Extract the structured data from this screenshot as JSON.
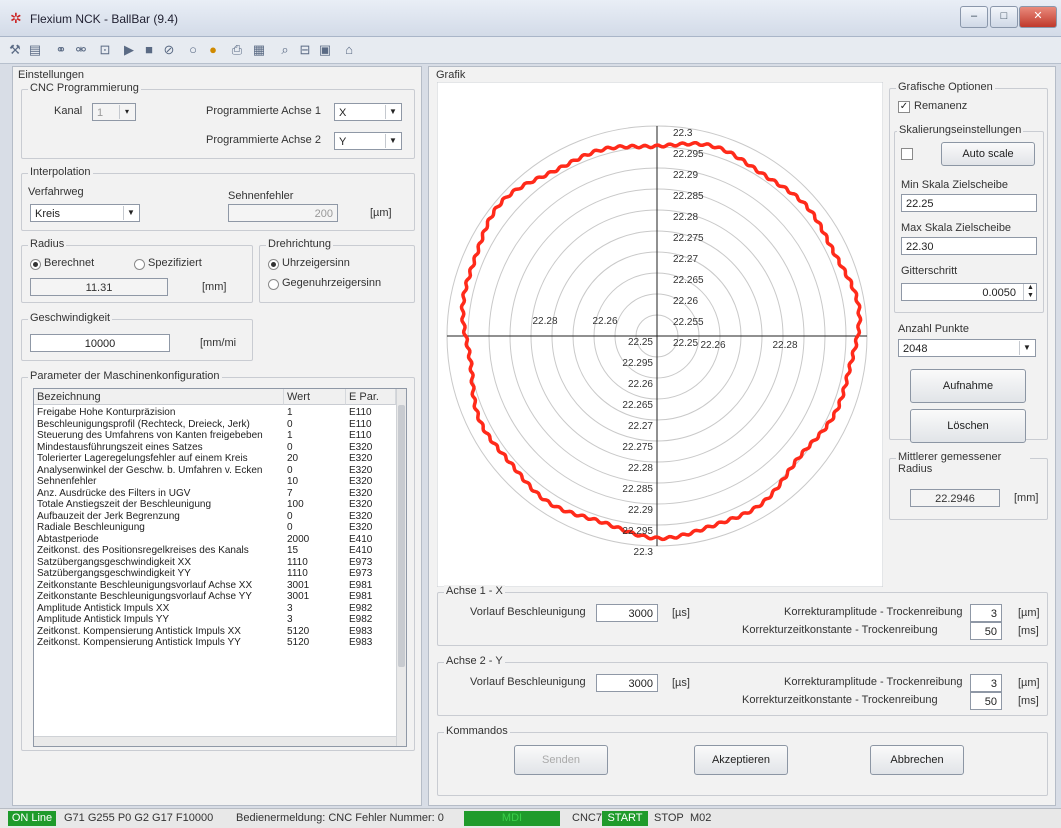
{
  "window": {
    "title": "Flexium NCK - BallBar (9.4)",
    "min": "–",
    "max": "□",
    "close": "✕"
  },
  "settings": {
    "title": "Einstellungen",
    "cnc": {
      "title": "CNC Programmierung",
      "kanal_label": "Kanal",
      "kanal_value": "1",
      "achse1_label": "Programmierte Achse 1",
      "achse1_value": "X",
      "achse2_label": "Programmierte Achse 2",
      "achse2_value": "Y"
    },
    "interpolation": {
      "title": "Interpolation",
      "verfahrweg_label": "Verfahrweg",
      "verfahrweg_value": "Kreis",
      "sehnenfehler_label": "Sehnenfehler",
      "sehnenfehler_value": "200",
      "unit": "[µm]"
    },
    "radius": {
      "title": "Radius",
      "opt1": "Berechnet",
      "opt2": "Spezifiziert",
      "value": "11.31",
      "unit": "[mm]"
    },
    "drehrichtung": {
      "title": "Drehrichtung",
      "opt1": "Uhrzeigersinn",
      "opt2": "Gegenuhrzeigersinn"
    },
    "geschwindigkeit": {
      "title": "Geschwindigkeit",
      "value": "10000",
      "unit": "[mm/mi"
    }
  },
  "params": {
    "title": "Parameter der Maschinenkonfiguration",
    "headers": [
      "Bezeichnung",
      "Wert",
      "E Par."
    ],
    "rows": [
      [
        "Freigabe Hohe Konturpräzision",
        "1",
        "E110"
      ],
      [
        "Beschleunigungsprofil (Rechteck, Dreieck, Jerk)",
        "0",
        "E110"
      ],
      [
        "Steuerung des Umfahrens von Kanten freigebeben",
        "1",
        "E110"
      ],
      [
        "Mindestausführungszeit eines Satzes",
        "0",
        "E320"
      ],
      [
        "Tolerierter Lageregelungsfehler auf einem Kreis",
        "20",
        "E320"
      ],
      [
        "Analysenwinkel der Geschw. b. Umfahren v. Ecken",
        "0",
        "E320"
      ],
      [
        "Sehnenfehler",
        "10",
        "E320"
      ],
      [
        "Anz. Ausdrücke des Filters in UGV",
        "7",
        "E320"
      ],
      [
        "Totale Anstiegszeit der Beschleunigung",
        "100",
        "E320"
      ],
      [
        "Aufbauzeit der Jerk Begrenzung",
        "0",
        "E320"
      ],
      [
        "Radiale Beschleunigung",
        "0",
        "E320"
      ],
      [
        "Abtastperiode",
        "2000",
        "E410"
      ],
      [
        "Zeitkonst. des Positionsregelkreises des Kanals",
        "15",
        "E410"
      ],
      [
        "Satzübergangsgeschwindigkeit XX",
        "1110",
        "E973"
      ],
      [
        "Satzübergangsgeschwindigkeit YY",
        "1110",
        "E973"
      ],
      [
        "Zeitkonstante Beschleunigungsvorlauf Achse XX",
        "3001",
        "E981"
      ],
      [
        "Zeitkonstante Beschleunigungsvorlauf Achse YY",
        "3001",
        "E981"
      ],
      [
        "Amplitude Antistick Impuls XX",
        "3",
        "E982"
      ],
      [
        "Amplitude Antistick Impuls YY",
        "3",
        "E982"
      ],
      [
        "Zeitkonst. Kompensierung Antistick Impuls XX",
        "5120",
        "E983"
      ],
      [
        "Zeitkonst. Kompensierung Antistick Impuls YY",
        "5120",
        "E983"
      ]
    ]
  },
  "grafik": {
    "title": "Grafik",
    "scale_labels": [
      "22.3",
      "22.295",
      "22.29",
      "22.285",
      "22.28",
      "22.275",
      "22.27",
      "22.265",
      "22.26",
      "22.255",
      "22.25"
    ],
    "scale_labels_down": [
      "22.25",
      "22.295",
      "22.26",
      "22.265",
      "22.27",
      "22.275",
      "22.28",
      "22.285",
      "22.29",
      "22.295",
      "22.3"
    ],
    "h_left": [
      "22.28",
      "22.26"
    ],
    "h_right": [
      "22.26",
      "22.28"
    ],
    "options": {
      "title": "Grafische Optionen",
      "remanenz": "Remanenz",
      "skal_title": "Skalierungseinstellungen",
      "autoscale": "Auto scale",
      "min_label": "Min Skala Zielscheibe",
      "min_value": "22.25",
      "max_label": "Max Skala Zielscheibe",
      "max_value": "22.30",
      "gitter_label": "Gitterschritt",
      "gitter_value": "0.0050",
      "punkte_label": "Anzahl Punkte",
      "punkte_value": "2048",
      "aufnahme": "Aufnahme",
      "loeschen": "Löschen"
    },
    "radius": {
      "title": "Mittlerer gemessener Radius",
      "value": "22.2946",
      "unit": "[mm]"
    }
  },
  "achse1": {
    "title": "Achse 1 - X",
    "vorlauf_label": "Vorlauf Beschleunigung",
    "vorlauf_value": "3000",
    "vorlauf_unit": "[µs]",
    "amp_label": "Korrekturamplitude - Trockenreibung",
    "amp_value": "3",
    "amp_unit": "[µm]",
    "zeit_label": "Korrekturzeitkonstante - Trockenreibung",
    "zeit_value": "50",
    "zeit_unit": "[ms]"
  },
  "achse2": {
    "title": "Achse 2 - Y",
    "vorlauf_label": "Vorlauf Beschleunigung",
    "vorlauf_value": "3000",
    "vorlauf_unit": "[µs]",
    "amp_label": "Korrekturamplitude - Trockenreibung",
    "amp_value": "3",
    "amp_unit": "[µm]",
    "zeit_label": "Korrekturzeitkonstante - Trockenreibung",
    "zeit_value": "50",
    "zeit_unit": "[ms]"
  },
  "kommandos": {
    "title": "Kommandos",
    "senden": "Senden",
    "akzeptieren": "Akzeptieren",
    "abbrechen": "Abbrechen"
  },
  "status": {
    "online": "ON Line",
    "gcode": "G71 G255 P0 G2 G17 F10000",
    "meldung": "Bedienermeldung:  CNC Fehler Nummer: 0",
    "mdi": "MDI",
    "cnc": "CNC7",
    "start": "START",
    "stop": "STOP",
    "m02": "M02"
  },
  "colors": {
    "trace": "#ff2a1a",
    "green": "#1f9b2b"
  }
}
